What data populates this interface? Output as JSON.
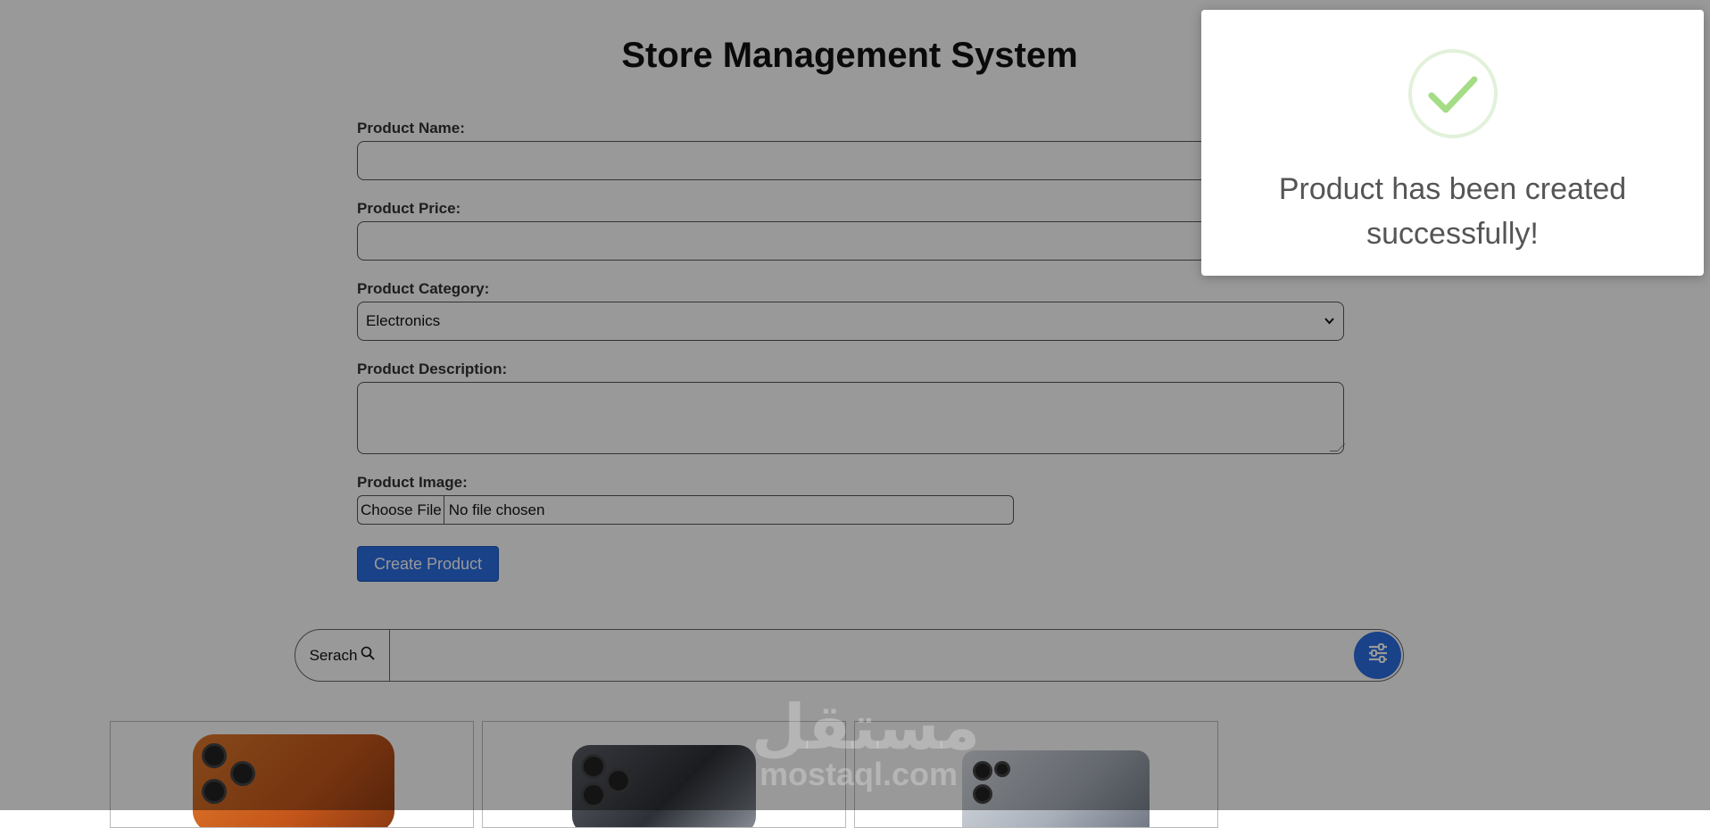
{
  "page": {
    "title": "Store Management System"
  },
  "form": {
    "name_label": "Product Name:",
    "name_value": "",
    "price_label": "Product Price:",
    "price_value": "",
    "category_label": "Product Category:",
    "category_value": "Electronics",
    "description_label": "Product Description:",
    "description_value": "",
    "image_label": "Product Image:",
    "file_button": "Choose File",
    "file_status": "No file chosen",
    "submit": "Create Product"
  },
  "search": {
    "addon_label": "Serach",
    "value": ""
  },
  "products": [
    {
      "image": "orange-phone"
    },
    {
      "image": "titanium-phone"
    },
    {
      "image": "silver-phone"
    }
  ],
  "watermark": {
    "arabic": "مستقل",
    "latin": "mostaql.com"
  },
  "toast": {
    "message": "Product has been created successfully!",
    "icon": "success-check-icon"
  },
  "colors": {
    "accent": "#2a6fe3",
    "success": "#a5dc86",
    "overlay": "rgba(0,0,0,0.40)"
  }
}
